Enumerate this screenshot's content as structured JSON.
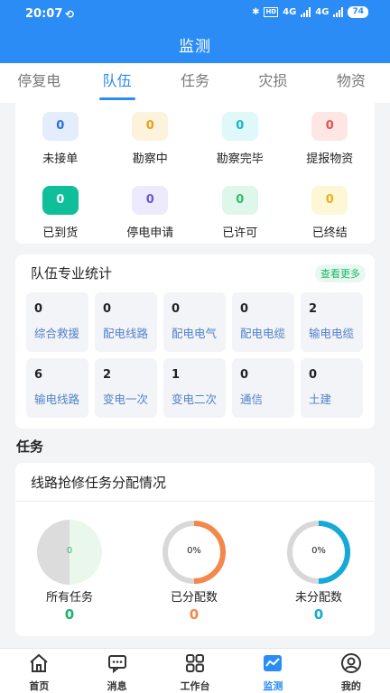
{
  "status_bar": {
    "time": "20:07",
    "network": "4G",
    "battery": "74"
  },
  "header": {
    "title": "监测"
  },
  "tabs": [
    {
      "label": "停复电",
      "active": false
    },
    {
      "label": "队伍",
      "active": true
    },
    {
      "label": "任务",
      "active": false
    },
    {
      "label": "灾损",
      "active": false
    },
    {
      "label": "物资",
      "active": false
    }
  ],
  "status_items": [
    {
      "label": "未接单",
      "count": "0",
      "color": "#2b6fd6",
      "bg": "#e3edfc"
    },
    {
      "label": "勘察中",
      "count": "0",
      "color": "#e6a21b",
      "bg": "#fdf2dc"
    },
    {
      "label": "勘察完毕",
      "count": "0",
      "color": "#19b8c8",
      "bg": "#dff8fa"
    },
    {
      "label": "提报物资",
      "count": "0",
      "color": "#e0554e",
      "bg": "#fde6e4"
    },
    {
      "label": "已到货",
      "count": "0",
      "color": "#ffffff",
      "bg": "#0fbf9a"
    },
    {
      "label": "停电申请",
      "count": "0",
      "color": "#6b57d8",
      "bg": "#eceafc"
    },
    {
      "label": "已许可",
      "count": "0",
      "color": "#2bbf6f",
      "bg": "#dff7ea"
    },
    {
      "label": "已终结",
      "count": "0",
      "color": "#e4b21c",
      "bg": "#fdf7d6"
    }
  ],
  "team_stats": {
    "title": "队伍专业统计",
    "more": "查看更多",
    "items": [
      {
        "count": "0",
        "label": "综合救援"
      },
      {
        "count": "0",
        "label": "配电线路"
      },
      {
        "count": "0",
        "label": "配电电气"
      },
      {
        "count": "0",
        "label": "配电电缆"
      },
      {
        "count": "2",
        "label": "输电电缆"
      },
      {
        "count": "6",
        "label": "输电线路"
      },
      {
        "count": "2",
        "label": "变电一次"
      },
      {
        "count": "1",
        "label": "变电二次"
      },
      {
        "count": "0",
        "label": "通信"
      },
      {
        "count": "0",
        "label": "土建"
      }
    ]
  },
  "tasks": {
    "section": "任务",
    "title": "线路抢修任务分配情况",
    "charts": [
      {
        "center": "0",
        "caption": "所有任务",
        "value": "0",
        "value_color": "#1bb56b",
        "accent": "#2bbf6f"
      },
      {
        "center": "0%",
        "caption": "已分配数",
        "value": "0",
        "value_color": "#f4884a",
        "accent": "#f4884a"
      },
      {
        "center": "0%",
        "caption": "未分配数",
        "value": "0",
        "value_color": "#14a9d6",
        "accent": "#14a9d6"
      }
    ]
  },
  "bottom_nav": [
    {
      "label": "首页",
      "icon": "home-icon"
    },
    {
      "label": "消息",
      "icon": "message-icon"
    },
    {
      "label": "工作台",
      "icon": "workbench-icon"
    },
    {
      "label": "监测",
      "icon": "monitor-icon",
      "active": true
    },
    {
      "label": "我的",
      "icon": "profile-icon"
    }
  ]
}
